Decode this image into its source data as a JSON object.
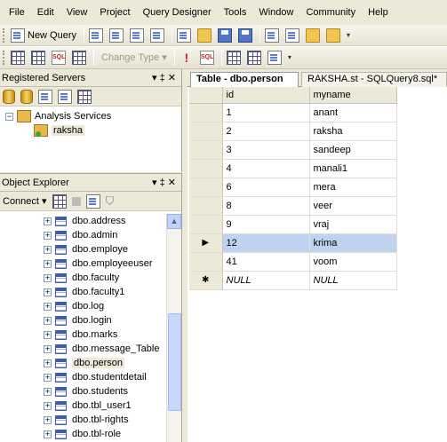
{
  "menu": [
    "File",
    "Edit",
    "View",
    "Project",
    "Query Designer",
    "Tools",
    "Window",
    "Community",
    "Help"
  ],
  "toolbar1": {
    "new_query_label": "New Query"
  },
  "toolbar2": {
    "change_type_label": "Change Type ▾"
  },
  "registered_servers": {
    "title": "Registered Servers",
    "pin_label": "▾ ‡ ✕",
    "root_label": "Analysis Services",
    "child_label": "raksha"
  },
  "object_explorer": {
    "title": "Object Explorer",
    "pin_label": "▾ ‡ ✕",
    "connect_label": "Connect ▾",
    "items": [
      "dbo.address",
      "dbo.admin",
      "dbo.employe",
      "dbo.employeeuser",
      "dbo.faculty",
      "dbo.faculty1",
      "dbo.log",
      "dbo.login",
      "dbo.marks",
      "dbo.message_Table",
      "dbo.person",
      "dbo.studentdetail",
      "dbo.students",
      "dbo.tbl_user1",
      "dbo.tbl-rights",
      "dbo.tbl-role"
    ],
    "selected_item": "dbo.person"
  },
  "tabs": {
    "active": "Table - dbo.person",
    "inactive": "RAKSHA.st - SQLQuery8.sql*"
  },
  "grid": {
    "columns": [
      "id",
      "myname"
    ],
    "rows": [
      [
        "1",
        "anant"
      ],
      [
        "2",
        "raksha"
      ],
      [
        "3",
        "sandeep"
      ],
      [
        "4",
        "manali1"
      ],
      [
        "6",
        "mera"
      ],
      [
        "8",
        "veer"
      ],
      [
        "9",
        "vraj"
      ],
      [
        "12",
        "krima"
      ],
      [
        "41",
        "voom"
      ]
    ],
    "current_row_index": 7,
    "current_row_marker": "▶",
    "new_row_marker": "✱",
    "null_label": "NULL"
  }
}
